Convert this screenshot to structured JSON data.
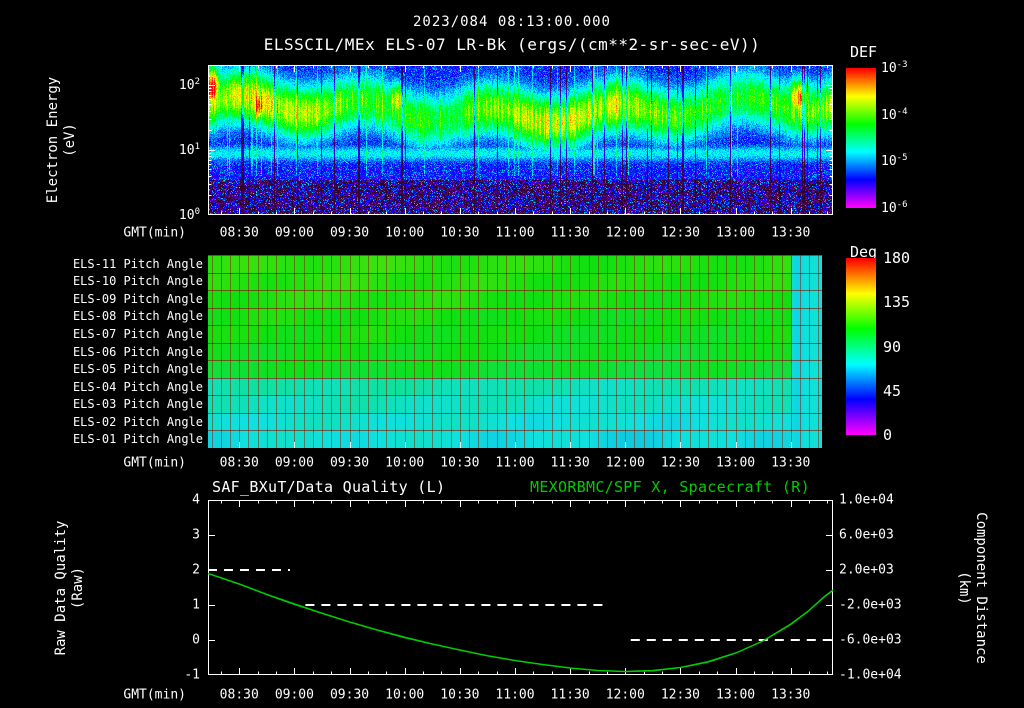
{
  "header": {
    "title": "2023/084 08:13:00.000",
    "subtitle": "ELSSCIL/MEx ELS-07 LR-Bk  (ergs/(cm**2-sr-sec-eV))"
  },
  "time_axis": {
    "label": "GMT(min)",
    "start_hour": 8.2167,
    "end_hour": 13.8833,
    "tick_hours": [
      8.5,
      9,
      9.5,
      10,
      10.5,
      11,
      11.5,
      12,
      12.5,
      13,
      13.5
    ],
    "tick_labels": [
      "08:30",
      "09:00",
      "09:30",
      "10:00",
      "10:30",
      "11:00",
      "11:30",
      "12:00",
      "12:30",
      "13:00",
      "13:30"
    ]
  },
  "spectrogram_panel": {
    "ylabel_lines": [
      "Electron Energy",
      "(eV)"
    ],
    "ytick_exponents": [
      0,
      1,
      2
    ],
    "y_log_range": [
      0,
      2.3
    ],
    "colorbar": {
      "title": "DEF",
      "tick_exponents": [
        -3,
        -4,
        -5,
        -6
      ],
      "log_range": [
        -6,
        -3
      ]
    }
  },
  "pitch_panel": {
    "colorbar": {
      "title": "Deg",
      "ticks": [
        180,
        135,
        90,
        45,
        0
      ],
      "range": [
        0,
        180
      ]
    },
    "end_transition": {
      "start_frac": 0.933,
      "value_deg": 72,
      "no_data_after_frac": 0.982
    }
  },
  "line_panel": {
    "title_left": "SAF_BXuT/Data Quality (L)",
    "title_right": "MEXORBMC/SPF X, Spacecraft (R)",
    "left_axis": {
      "label_lines": [
        "Raw Data Quality",
        "(Raw)"
      ],
      "ticks": [
        4,
        3,
        2,
        1,
        0,
        -1
      ],
      "range": [
        -1,
        4
      ]
    },
    "right_axis": {
      "label_lines": [
        "Component Distance",
        "(km)"
      ],
      "tick_labels": [
        "1.0e+04",
        "6.0e+03",
        "2.0e+03",
        "-2.0e+03",
        "-6.0e+03",
        "-1.0e+04"
      ],
      "range": [
        -10000,
        10000
      ]
    },
    "colors": {
      "quality": "#ffffff",
      "distance": "#00cc00"
    }
  },
  "chart_data": [
    {
      "type": "heatmap",
      "title": "ELSSCIL/MEx ELS-07 LR-Bk",
      "units": "ergs/(cm**2-sr-sec-eV)",
      "xlabel": "GMT(min)",
      "ylabel": "Electron Energy (eV)",
      "y_scale": "log",
      "y_range_eV": [
        1,
        200
      ],
      "color_scale_log10": [
        -6,
        -3
      ],
      "structure": {
        "background_log10": -5.45,
        "main_band": {
          "loge_center": 1.62,
          "loge_sigma": 0.3,
          "peak_log10": -3.95,
          "wobble": 0.12
        },
        "low_band": {
          "loge_center": 0.95,
          "loge_sigma": 0.09,
          "peak_log10": -4.8
        },
        "bottom_speckle_below_loge": 0.55,
        "hot_spots": [
          {
            "t_frac": 0.005,
            "loge": 1.95,
            "t_sigma": 0.012,
            "e_sigma": 0.25,
            "boost": 0.85
          },
          {
            "t_frac": 0.08,
            "loge": 1.7,
            "t_sigma": 0.01,
            "e_sigma": 0.2,
            "boost": 0.5
          },
          {
            "t_frac": 0.3,
            "loge": 1.75,
            "t_sigma": 0.012,
            "e_sigma": 0.2,
            "boost": 0.55
          },
          {
            "t_frac": 0.945,
            "loge": 1.8,
            "t_sigma": 0.015,
            "e_sigma": 0.22,
            "boost": 0.7
          }
        ]
      },
      "features": [
        "broad bright flux band ~20-100 eV across entire interval, DEF ~1e-4 to 1e-3",
        "narrow cyan band near 8-10 eV, DEF ~1e-5 to 3e-5",
        "dark blue/black speckled background below ~5 eV, DEF <= 1e-6",
        "red-orange enhancements near 08:15 and 13:20 at 60-150 eV"
      ]
    },
    {
      "type": "heatmap",
      "title": "ELS Pitch Angles",
      "colorbar_label": "Deg",
      "value_range_deg": [
        0,
        180
      ],
      "rows": [
        {
          "label": "ELS-11 Pitch Angle",
          "mean_deg": 112
        },
        {
          "label": "ELS-10 Pitch Angle",
          "mean_deg": 111
        },
        {
          "label": "ELS-09 Pitch Angle",
          "mean_deg": 110
        },
        {
          "label": "ELS-08 Pitch Angle",
          "mean_deg": 108
        },
        {
          "label": "ELS-07 Pitch Angle",
          "mean_deg": 107
        },
        {
          "label": "ELS-06 Pitch Angle",
          "mean_deg": 105
        },
        {
          "label": "ELS-05 Pitch Angle",
          "mean_deg": 103
        },
        {
          "label": "ELS-04 Pitch Angle",
          "mean_deg": 80
        },
        {
          "label": "ELS-03 Pitch Angle",
          "mean_deg": 77
        },
        {
          "label": "ELS-02 Pitch Angle",
          "mean_deg": 74
        },
        {
          "label": "ELS-01 Pitch Angle",
          "mean_deg": 72
        }
      ],
      "features": [
        "near-constant pitch angles 08:15-13:30 (green ~105-112 deg top anodes, cyan ~72-80 deg bottom anodes)",
        "all anodes shift to ~72 deg (cyan) 13:30-13:45",
        "no data (black) after ~13:45"
      ]
    },
    {
      "type": "line",
      "xlabel": "GMT(min)",
      "ylim_left": [
        -1,
        4
      ],
      "ylim_right": [
        -10000,
        10000
      ],
      "series": [
        {
          "name": "SAF_BXuT/Data Quality (L)",
          "axis": "left",
          "style": "dashed",
          "color": "#ffffff",
          "segments": [
            {
              "t_start": 8.2167,
              "t_end": 8.96,
              "value": 2
            },
            {
              "t_start": 9.1,
              "t_end": 11.8,
              "value": 1
            },
            {
              "t_start": 12.05,
              "t_end": 13.8833,
              "value": 0
            }
          ]
        },
        {
          "name": "MEXORBMC/SPF X, Spacecraft (R)",
          "axis": "right",
          "style": "solid",
          "color": "#00cc00",
          "t": [
            8.2167,
            8.5,
            8.75,
            9.0,
            9.25,
            9.5,
            9.75,
            10.0,
            10.25,
            10.5,
            10.75,
            11.0,
            11.25,
            11.5,
            11.75,
            12.0,
            12.25,
            12.5,
            12.75,
            13.0,
            13.25,
            13.5,
            13.65,
            13.8,
            13.8833
          ],
          "km": [
            1600,
            400,
            -800,
            -1900,
            -2950,
            -3950,
            -4850,
            -5700,
            -6450,
            -7150,
            -7800,
            -8350,
            -8800,
            -9200,
            -9480,
            -9600,
            -9500,
            -9150,
            -8500,
            -7500,
            -6100,
            -4200,
            -2800,
            -1100,
            -300
          ]
        }
      ]
    }
  ]
}
